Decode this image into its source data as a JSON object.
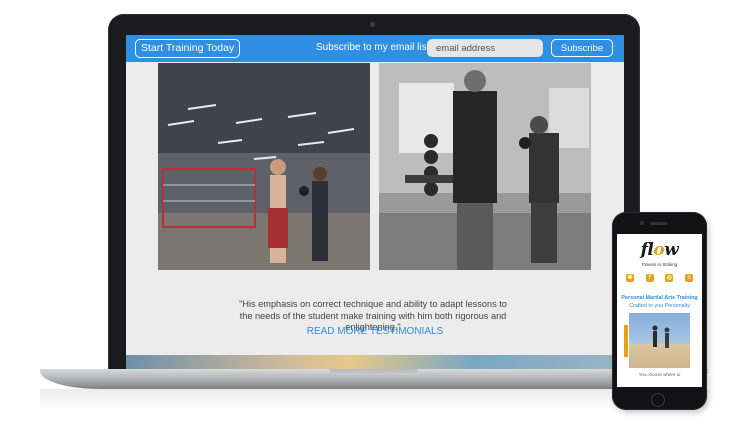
{
  "laptop_site": {
    "header": {
      "cta_label": "Start Training Today",
      "subscribe_label": "Subscribe to my email list:",
      "email_placeholder": "email address",
      "subscribe_button": "Subscribe",
      "accent_color": "#2f8fe3"
    },
    "testimonial": {
      "quote": "\"His emphasis on correct technique and ability to adapt lessons to the needs of the student make training with him both rigorous and enlightening.\"",
      "more_link": "READ MORE TESTIMONIALS"
    }
  },
  "mobile_site": {
    "logo": {
      "text_start": "fl",
      "text_accent": "o",
      "text_end": "w"
    },
    "tagline": "Fitness in Striking",
    "social_icons": [
      "yelp-icon",
      "facebook-icon",
      "instagram-icon",
      "menu-icon"
    ],
    "heading": "Personal Martial Arts Training",
    "subheading": "Crafted to you Personally",
    "caption": "You choose where to",
    "accent_color": "#e7a11b"
  }
}
